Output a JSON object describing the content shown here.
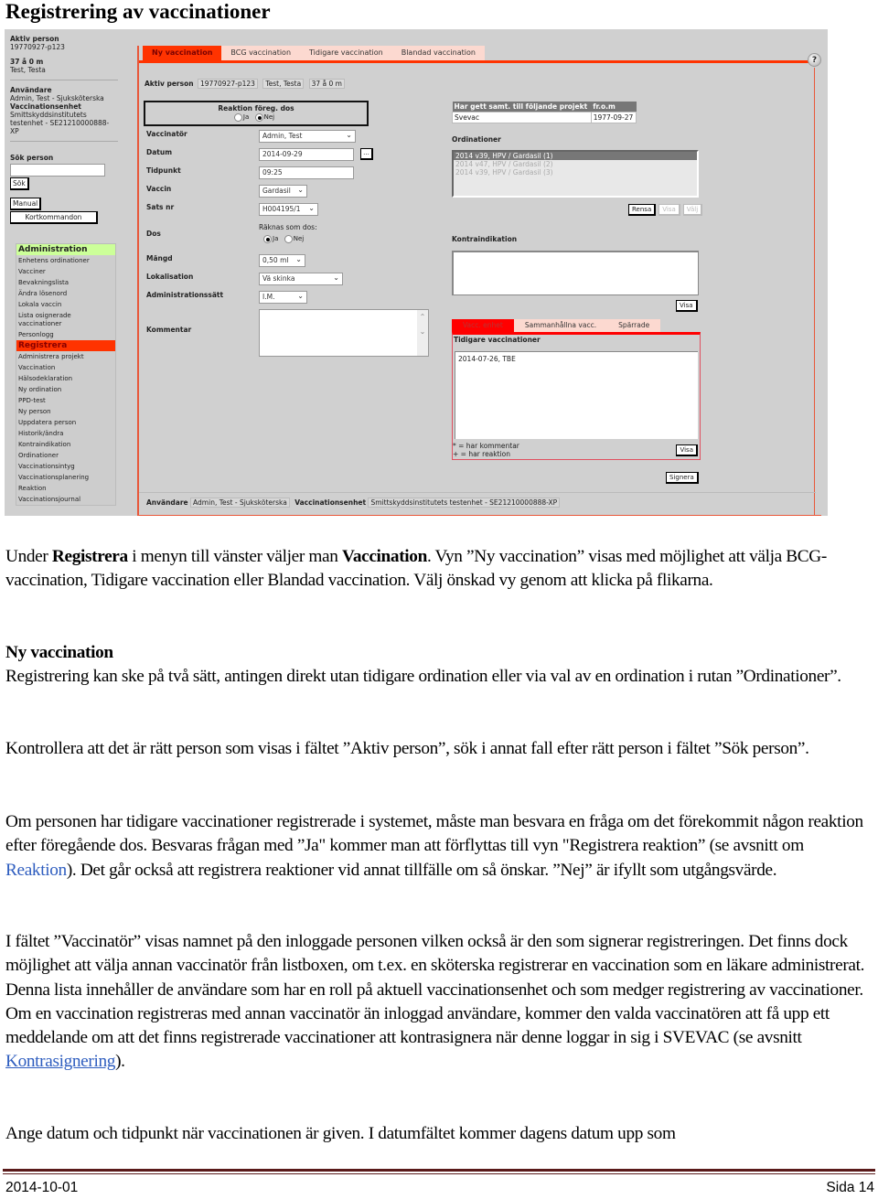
{
  "doc": {
    "title": "Registrering av vaccinationer",
    "footer_date": "2014-10-01",
    "footer_page": "Sida 14"
  },
  "app": {
    "sidebar": {
      "aktiv_label": "Aktiv person",
      "aktiv_id": "19770927-p123",
      "age": "37 å 0 m",
      "name": "Test, Testa",
      "user_label": "Användare",
      "user_value": "Admin, Test - Sjuksköterska",
      "unit_label": "Vaccinationsenhet",
      "unit_value_1": "Smittskyddsinstitutets",
      "unit_value_2": "testenhet - SE21210000888-",
      "unit_value_3": "XP",
      "search_label": "Sök person",
      "search_value": "",
      "search_button": "Sök",
      "manual_button": "Manual",
      "shortcuts_button": "Kortkommandon"
    },
    "menu": {
      "admin_header": "Administration",
      "admin_items": [
        "Enhetens ordinationer",
        "Vacciner",
        "Bevakningslista",
        "Ändra lösenord",
        "Lokala vaccin",
        "Lista osignerade vaccinationer",
        "Personlogg"
      ],
      "reg_header": "Registrera",
      "reg_items": [
        "Administrera projekt",
        "Vaccination",
        "Hälsodeklaration",
        "Ny ordination",
        "PPD-test",
        "Ny person",
        "Uppdatera person",
        "Historik/ändra",
        "Kontraindikation",
        "Ordinationer",
        "Vaccinationsintyg",
        "Vaccinationsplanering",
        "Reaktion",
        "Vaccinationsjournal"
      ]
    },
    "tabs": [
      "Ny vaccination",
      "BCG vaccination",
      "Tidigare vaccination",
      "Blandad vaccination"
    ],
    "help_icon": "?",
    "aktiv": {
      "label": "Aktiv person",
      "id": "19770927-p123",
      "name": "Test, Testa",
      "age": "37 å 0 m"
    },
    "reaktion": {
      "title": "Reaktion föreg. dos",
      "ja": "Ja",
      "nej": "Nej",
      "selected": "Nej"
    },
    "form": {
      "vaccinator_label": "Vaccinatör",
      "vaccinator_value": "Admin, Test",
      "datum_label": "Datum",
      "datum_value": "2014-09-29",
      "datum_picker": "...",
      "tidpunkt_label": "Tidpunkt",
      "tidpunkt_value": "09:25",
      "vaccin_label": "Vaccin",
      "vaccin_value": "Gardasil",
      "sats_label": "Sats nr",
      "sats_value": "H004195/1",
      "dos_label": "Dos",
      "dos_text": "Räknas som dos:",
      "dos_ja": "Ja",
      "dos_nej": "Nej",
      "dos_selected": "Ja",
      "mangd_label": "Mängd",
      "mangd_value": "0,50 ml",
      "lokalisation_label": "Lokalisation",
      "lokalisation_value": "Vä skinka",
      "adm_label": "Administrationssätt",
      "adm_value": "I.M.",
      "kommentar_label": "Kommentar",
      "kommentar_value": ""
    },
    "projekt": {
      "headers": [
        "Har gett samt. till följande projekt",
        "fr.o.m"
      ],
      "rows": [
        [
          "Svevac",
          "1977-09-27"
        ]
      ]
    },
    "ordinationer": {
      "label": "Ordinationer",
      "items": [
        "2014 v39, HPV / Gardasil (1)",
        "2014 v47, HPV / Gardasil (2)",
        "2014 v39, HPV / Gardasil (3)"
      ],
      "selected_index": 0,
      "rensa": "Rensa",
      "visa": "Visa",
      "valj": "Välj"
    },
    "kontra": {
      "label": "Kontraindikation",
      "visa": "Visa"
    },
    "vtabs": [
      "Vacc. enhet",
      "Sammanhållna vacc.",
      "Spärrade"
    ],
    "tidigare": {
      "title": "Tidigare vaccinationer",
      "items": [
        "2014-07-26, TBE"
      ],
      "legend_1": "* = har kommentar",
      "legend_2": "+ = har reaktion",
      "visa": "Visa"
    },
    "signera": "Signera",
    "footer": {
      "user_label": "Användare",
      "user_value": "Admin, Test - Sjuksköterska",
      "unit_label": "Vaccinationsenhet",
      "unit_value": "Smittskyddsinstitutets testenhet - SE21210000888-XP"
    }
  },
  "text": {
    "p1_a": "Under ",
    "p1_b": "Registrera",
    "p1_c": " i menyn till vänster väljer man ",
    "p1_d": "Vaccination",
    "p1_e": ". Vyn ”Ny vaccination” visas med möjlighet att välja BCG-vaccination, Tidigare vaccination eller Blandad vaccination. Välj önskad vy genom att klicka på flikarna.",
    "p2_head": "Ny vaccination",
    "p2_body": "Registrering kan ske på två sätt, antingen direkt utan tidigare ordination eller via val av en ordination i rutan ”Ordinationer”.",
    "p3": "Kontrollera att det är rätt person som visas i fältet ”Aktiv person”, sök i annat fall efter rätt person i fältet ”Sök person”.",
    "p4_a": "Om personen har tidigare vaccinationer registrerade i systemet, måste man besvara en fråga om det förekommit någon reaktion efter föregående dos. Besvaras frågan med ”Ja\" kommer man att förflyttas till vyn \"Registrera reaktion” (se avsnitt om ",
    "p4_link": "Reaktion",
    "p4_b": "). Det går också att registrera reaktioner vid annat tillfälle om så önskar. ”Nej” är ifyllt som utgångsvärde.",
    "p5_a": "I fältet ”Vaccinatör” visas namnet på den inloggade personen vilken också är den som signerar registreringen. Det finns dock möjlighet att välja annan vaccinatör från listboxen, om t.ex. en sköterska registrerar en vaccination som en läkare administrerat. Denna lista innehåller de användare som har en roll på aktuell vaccinationsenhet och som medger registrering av vaccinationer. Om en vaccination registreras med annan vaccinatör än inloggad användare, kommer den valda vaccinatören att få upp ett meddelande om att det finns registrerade vaccinationer att kontrasignera när denne loggar in sig i SVEVAC (se avsnitt ",
    "p5_link": "Kontrasignering",
    "p5_b": ").",
    "p6": "Ange datum och tidpunkt när vaccinationen är given. I datumfältet kommer dagens datum upp som"
  }
}
